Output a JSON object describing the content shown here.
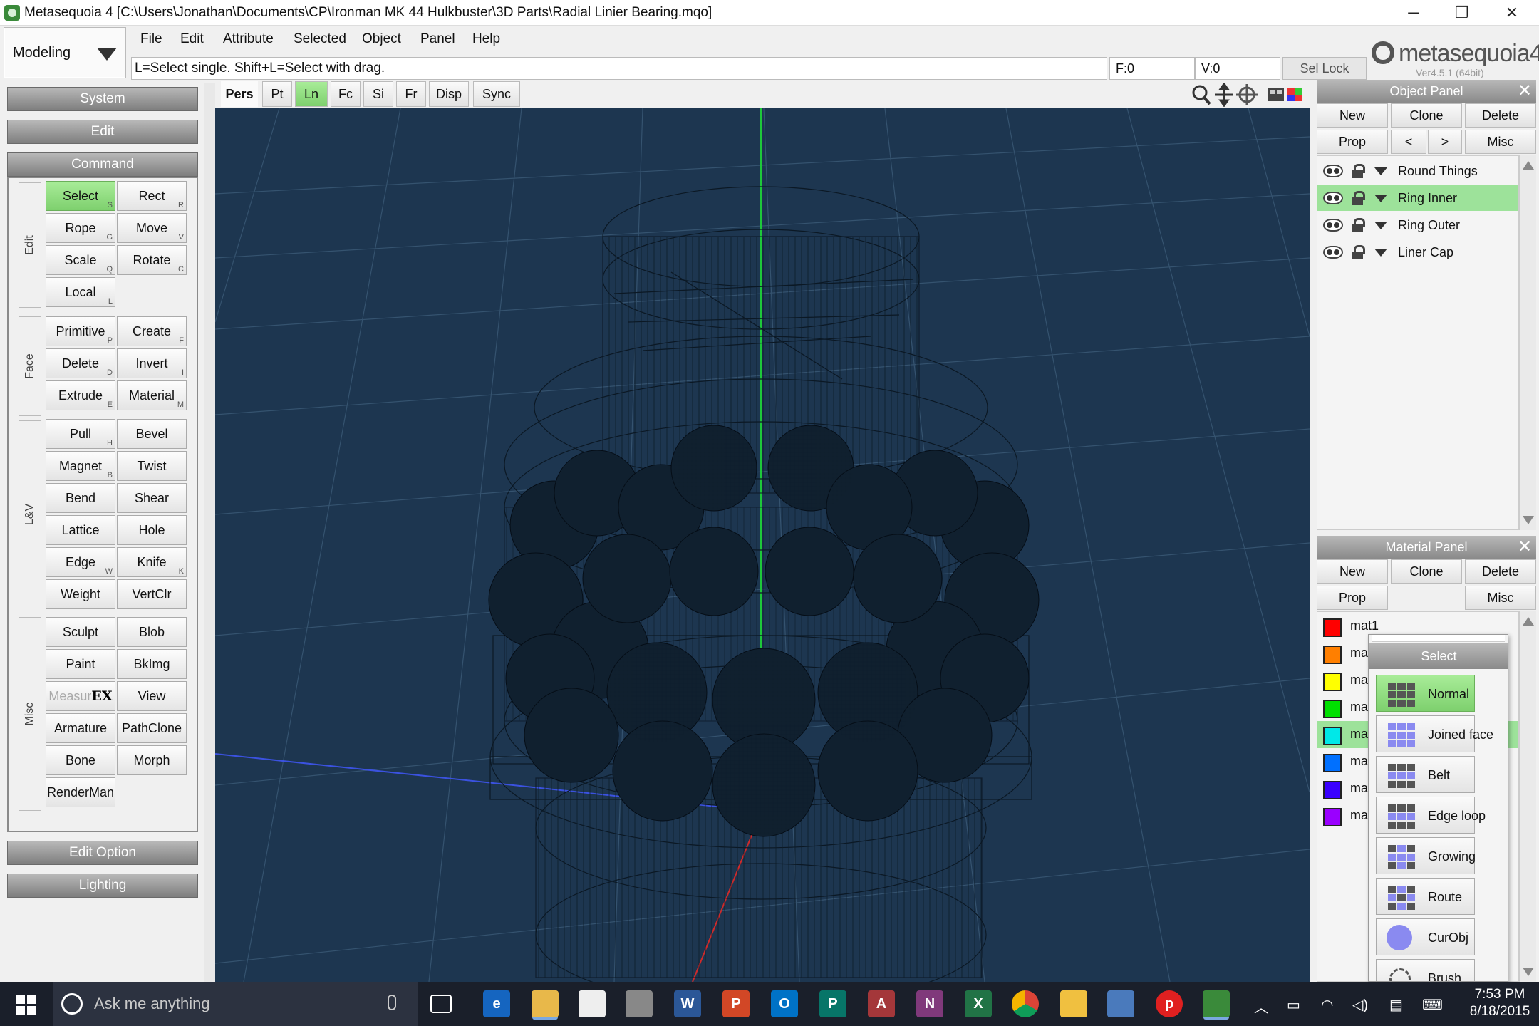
{
  "window": {
    "title": "Metasequoia 4 [C:\\Users\\Jonathan\\Documents\\CP\\Ironman MK 44 Hulkbuster\\3D Parts\\Radial Linier Bearing.mqo]",
    "minimize": "─",
    "restore": "❐",
    "close": "✕"
  },
  "mode": {
    "label": "Modeling"
  },
  "menu": [
    "File",
    "Edit",
    "Attribute",
    "Selected",
    "Object",
    "Panel",
    "Help"
  ],
  "status": {
    "hint": "L=Select single.  Shift+L=Select with drag.",
    "faces": "F:0",
    "verts": "V:0",
    "sel_lock": "Sel Lock"
  },
  "logo": {
    "text": "metasequoia4",
    "version": "Ver4.5.1 (64bit)"
  },
  "left_panel": {
    "system": "System",
    "edit": "Edit",
    "command": "Command",
    "edit_option": "Edit Option",
    "lighting": "Lighting",
    "groups": {
      "edit": "Edit",
      "face": "Face",
      "lv": "L&V",
      "misc": "Misc"
    },
    "buttons": {
      "select": {
        "label": "Select",
        "key": "S"
      },
      "rect": {
        "label": "Rect",
        "key": "R"
      },
      "rope": {
        "label": "Rope",
        "key": "G"
      },
      "move": {
        "label": "Move",
        "key": "V"
      },
      "scale": {
        "label": "Scale",
        "key": "Q"
      },
      "rotate": {
        "label": "Rotate",
        "key": "C"
      },
      "local": {
        "label": "Local",
        "key": "L"
      },
      "primitive": {
        "label": "Primitive",
        "key": "P"
      },
      "create": {
        "label": "Create",
        "key": "F"
      },
      "delete": {
        "label": "Delete",
        "key": "D"
      },
      "invert": {
        "label": "Invert",
        "key": "I"
      },
      "extrude": {
        "label": "Extrude",
        "key": "E"
      },
      "material": {
        "label": "Material",
        "key": "M"
      },
      "pull": {
        "label": "Pull",
        "key": "H"
      },
      "bevel": {
        "label": "Bevel",
        "key": ""
      },
      "magnet": {
        "label": "Magnet",
        "key": "B"
      },
      "twist": {
        "label": "Twist",
        "key": ""
      },
      "bend": {
        "label": "Bend",
        "key": ""
      },
      "shear": {
        "label": "Shear",
        "key": ""
      },
      "lattice": {
        "label": "Lattice",
        "key": ""
      },
      "hole": {
        "label": "Hole",
        "key": ""
      },
      "edge": {
        "label": "Edge",
        "key": "W"
      },
      "knife": {
        "label": "Knife",
        "key": "K"
      },
      "weight": {
        "label": "Weight",
        "key": ""
      },
      "vertclr": {
        "label": "VertClr",
        "key": ""
      },
      "sculpt": {
        "label": "Sculpt",
        "key": ""
      },
      "blob": {
        "label": "Blob",
        "key": ""
      },
      "paint": {
        "label": "Paint",
        "key": ""
      },
      "bkimg": {
        "label": "BkImg",
        "key": ""
      },
      "measure": {
        "label": "Measur",
        "badge": "EX"
      },
      "view": {
        "label": "View",
        "key": ""
      },
      "armature": {
        "label": "Armature",
        "key": ""
      },
      "pathclone": {
        "label": "PathClone",
        "key": ""
      },
      "bone": {
        "label": "Bone",
        "key": ""
      },
      "morph": {
        "label": "Morph",
        "key": ""
      },
      "renderman": {
        "label": "RenderMan",
        "key": ""
      }
    }
  },
  "view_toolbar": {
    "tabs": [
      "Pers",
      "Pt",
      "Ln",
      "Fc",
      "Si",
      "Fr",
      "Disp",
      "Sync"
    ],
    "active": "Ln"
  },
  "object_panel": {
    "title": "Object Panel",
    "new": "New",
    "clone": "Clone",
    "delete": "Delete",
    "prop": "Prop",
    "prev": "<",
    "next": ">",
    "misc": "Misc",
    "objects": [
      {
        "name": "Round Things",
        "selected": false
      },
      {
        "name": "Ring Inner",
        "selected": true
      },
      {
        "name": "Ring Outer",
        "selected": false
      },
      {
        "name": "Liner Cap",
        "selected": false
      }
    ]
  },
  "material_panel": {
    "title": "Material Panel",
    "new": "New",
    "clone": "Clone",
    "delete": "Delete",
    "prop": "Prop",
    "misc": "Misc",
    "materials": [
      {
        "name": "mat1",
        "color": "#ff0000"
      },
      {
        "name": "ma",
        "color": "#ff7f00"
      },
      {
        "name": "ma",
        "color": "#ffff00"
      },
      {
        "name": "ma",
        "color": "#00e000"
      },
      {
        "name": "ma",
        "color": "#00e8e8",
        "selected": true
      },
      {
        "name": "ma",
        "color": "#0070ff"
      },
      {
        "name": "ma",
        "color": "#3a00ff"
      },
      {
        "name": "ma",
        "color": "#9a00ff"
      }
    ]
  },
  "select_popup": {
    "title": "Select",
    "items": [
      "Normal",
      "Joined face",
      "Belt",
      "Edge loop",
      "Growing",
      "Route",
      "CurObj",
      "Brush"
    ],
    "active": "Normal"
  },
  "taskbar": {
    "search_placeholder": "Ask me anything",
    "time": "7:53 PM",
    "date": "8/18/2015"
  },
  "colors": {
    "viewport_bg": "#1d3650",
    "active_green": "#8ee07e",
    "grid": "#3c5a78"
  }
}
